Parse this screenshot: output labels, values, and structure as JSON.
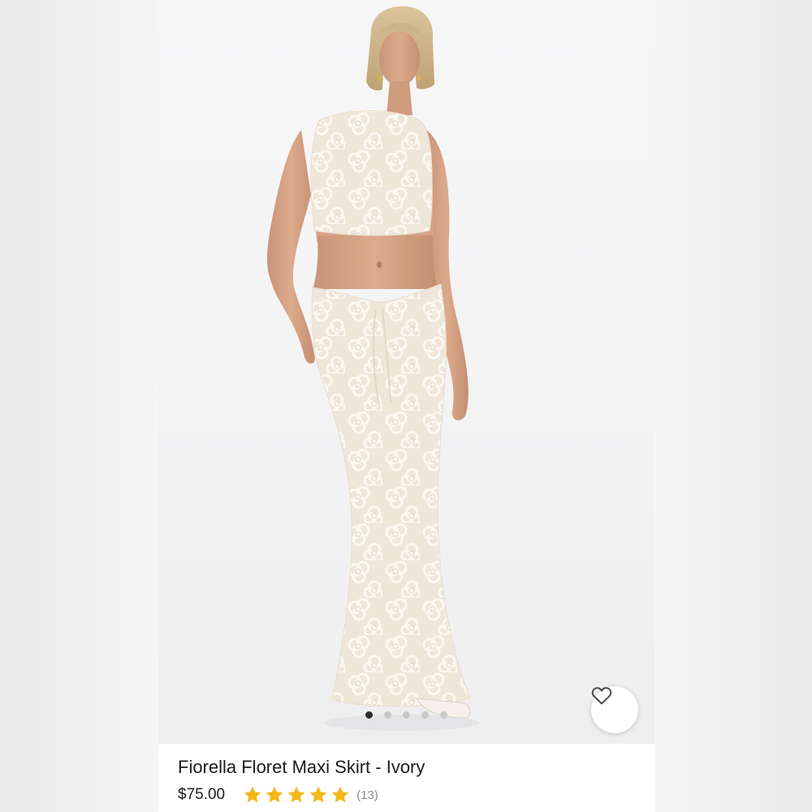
{
  "product": {
    "title": "Fiorella Floret Maxi Skirt - Ivory",
    "price": "$75.00",
    "rating": 5,
    "rating_max": 5,
    "review_count": "(13)"
  },
  "carousel": {
    "image_count": 5,
    "active_index": 0
  },
  "icons": {
    "favorite": "heart-outline-icon",
    "star": "star-filled-icon"
  },
  "colors": {
    "star": "#f5b718",
    "background": "#ffffff",
    "active_dot": "#2c2c2c",
    "inactive_dot": "#c8c8c8"
  }
}
